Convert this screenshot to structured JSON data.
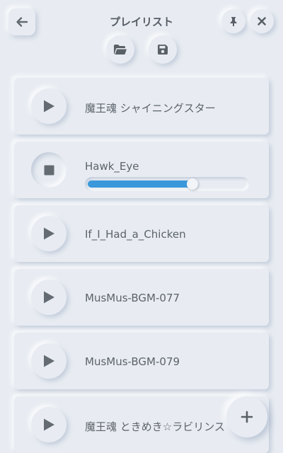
{
  "header": {
    "title": "プレイリスト",
    "back_icon": "arrow-left-icon",
    "pin_icon": "pin-icon",
    "close_icon": "close-icon",
    "open_icon": "folder-open-icon",
    "save_icon": "save-icon"
  },
  "tracks": [
    {
      "name": "魔王魂 シャイニングスター",
      "state": "stopped"
    },
    {
      "name": "Hawk_Eye",
      "state": "playing",
      "progress": 0.66
    },
    {
      "name": "If_I_Had_a_Chicken",
      "state": "stopped"
    },
    {
      "name": "MusMus-BGM-077",
      "state": "stopped"
    },
    {
      "name": "MusMus-BGM-079",
      "state": "stopped"
    },
    {
      "name": "魔王魂 ときめき☆ラビリンス",
      "state": "stopped"
    }
  ],
  "fab": {
    "icon": "plus-icon",
    "label": "+"
  },
  "colors": {
    "background": "#e8ecf2",
    "accent": "#3a98db",
    "icon": "#646b73"
  }
}
